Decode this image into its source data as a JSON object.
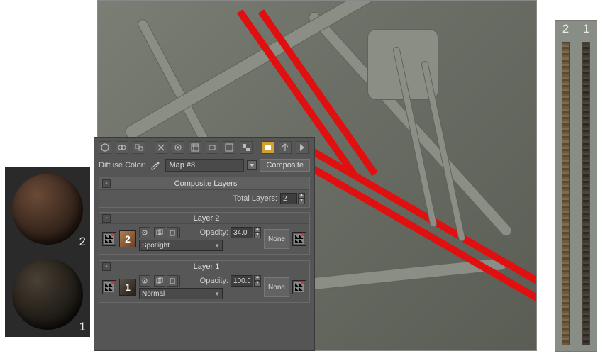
{
  "spheres": [
    {
      "num": "2"
    },
    {
      "num": "1"
    }
  ],
  "strips": [
    {
      "label": "2"
    },
    {
      "label": "1"
    }
  ],
  "panel": {
    "diffuse_label": "Diffuse Color:",
    "map_name": "Map #8",
    "map_type": "Composite",
    "composite": {
      "title": "Composite Layers",
      "total_label": "Total Layers:",
      "total_value": "2"
    },
    "layers": [
      {
        "title": "Layer 2",
        "thumb_label": "2",
        "opacity_label": "Opacity:",
        "opacity_value": "34.0",
        "blend_mode": "Spotlight",
        "mask_label": "None"
      },
      {
        "title": "Layer 1",
        "thumb_label": "1",
        "opacity_label": "Opacity:",
        "opacity_value": "100.0",
        "blend_mode": "Normal",
        "mask_label": "None"
      }
    ]
  }
}
